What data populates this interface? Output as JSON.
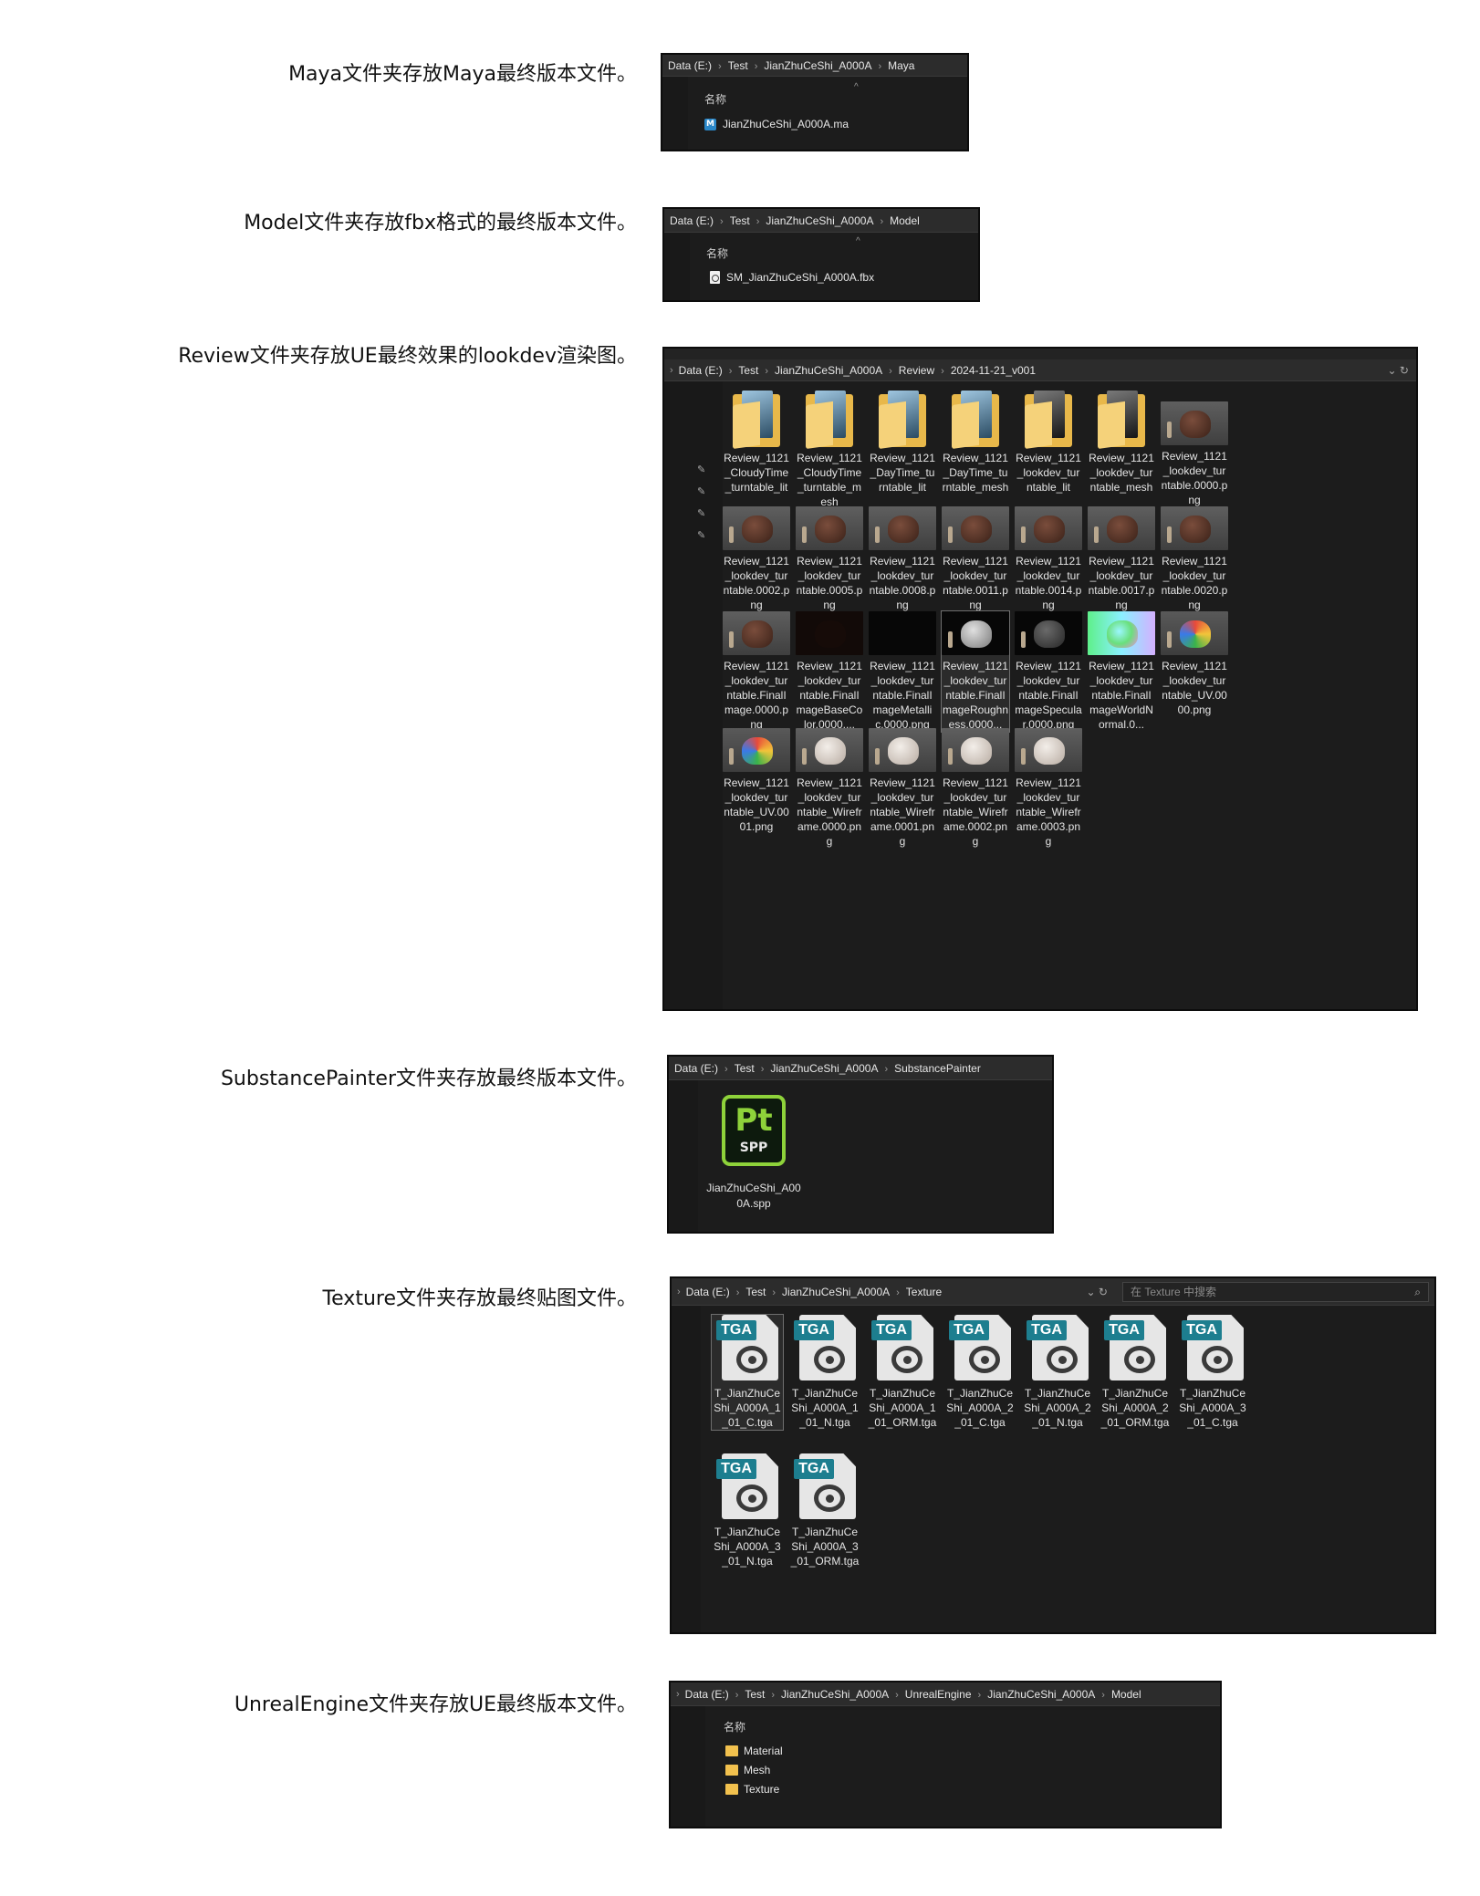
{
  "captions": {
    "maya": "Maya文件夹存放Maya最终版本文件。",
    "model": "Model文件夹存放fbx格式的最终版本文件。",
    "review": "Review文件夹存放UE最终效果的lookdev渲染图。",
    "substance": "SubstancePainter文件夹存放最终版本文件。",
    "texture": "Texture文件夹存放最终贴图文件。",
    "unreal": "UnrealEngine文件夹存放UE最终版本文件。"
  },
  "maya_window": {
    "breadcrumb": [
      "Data (E:)",
      "Test",
      "JianZhuCeShi_A000A",
      "Maya"
    ],
    "column_header": "名称",
    "file": "JianZhuCeShi_A000A.ma",
    "icon": "maya-file-icon"
  },
  "model_window": {
    "breadcrumb": [
      "Data (E:)",
      "Test",
      "JianZhuCeShi_A000A",
      "Model"
    ],
    "column_header": "名称",
    "file": "SM_JianZhuCeShi_A000A.fbx",
    "icon": "fbx-file-icon"
  },
  "review_window": {
    "breadcrumb": [
      "Data (E:)",
      "Test",
      "JianZhuCeShi_A000A",
      "Review",
      "2024-11-21_v001"
    ],
    "folders": [
      {
        "name": "Review_1121_CloudyTime_turntable_lit",
        "style": "light"
      },
      {
        "name": "Review_1121_CloudyTime_turntable_mesh",
        "style": "light"
      },
      {
        "name": "Review_1121_DayTime_turntable_lit",
        "style": "light"
      },
      {
        "name": "Review_1121_DayTime_turntable_mesh",
        "style": "light"
      },
      {
        "name": "Review_1121_lookdev_turntable_lit",
        "style": "dark"
      },
      {
        "name": "Review_1121_lookdev_turntable_mesh",
        "style": "dark"
      }
    ],
    "images": [
      {
        "name": "Review_1121_lookdev_turntable.0000.png",
        "thumb": "gray",
        "pot": "brown"
      },
      {
        "name": "Review_1121_lookdev_turntable.0002.png",
        "thumb": "gray",
        "pot": "brown"
      },
      {
        "name": "Review_1121_lookdev_turntable.0005.png",
        "thumb": "gray",
        "pot": "brown"
      },
      {
        "name": "Review_1121_lookdev_turntable.0008.png",
        "thumb": "gray",
        "pot": "brown"
      },
      {
        "name": "Review_1121_lookdev_turntable.0011.png",
        "thumb": "gray",
        "pot": "brown"
      },
      {
        "name": "Review_1121_lookdev_turntable.0014.png",
        "thumb": "gray",
        "pot": "brown"
      },
      {
        "name": "Review_1121_lookdev_turntable.0017.png",
        "thumb": "gray",
        "pot": "brown"
      },
      {
        "name": "Review_1121_lookdev_turntable.0020.png",
        "thumb": "gray",
        "pot": "brown"
      },
      {
        "name": "Review_1121_lookdev_turntable.FinalImage.0000.png",
        "thumb": "gray",
        "pot": "brown"
      },
      {
        "name": "Review_1121_lookdev_turntable.FinalImageBaseColor.0000....",
        "thumb": "dark",
        "pot": "basec"
      },
      {
        "name": "Review_1121_lookdev_turntable.FinalImageMetallic.0000.png",
        "thumb": "black",
        "pot": "none"
      },
      {
        "name": "Review_1121_lookdev_turntable.FinalImageRoughness.0000...",
        "thumb": "black",
        "pot": "rough"
      },
      {
        "name": "Review_1121_lookdev_turntable.FinalImageSpecular.0000.png",
        "thumb": "black",
        "pot": "spec"
      },
      {
        "name": "Review_1121_lookdev_turntable.FinalImageWorldNormal.0...",
        "thumb": "normal",
        "pot": "norm"
      },
      {
        "name": "Review_1121_lookdev_turntable_UV.0000.png",
        "thumb": "uv",
        "pot": "uvc"
      },
      {
        "name": "Review_1121_lookdev_turntable_UV.0001.png",
        "thumb": "uv",
        "pot": "uvc"
      },
      {
        "name": "Review_1121_lookdev_turntable_Wireframe.0000.png",
        "thumb": "gray",
        "pot": "white"
      },
      {
        "name": "Review_1121_lookdev_turntable_Wireframe.0001.png",
        "thumb": "gray",
        "pot": "white"
      },
      {
        "name": "Review_1121_lookdev_turntable_Wireframe.0002.png",
        "thumb": "gray",
        "pot": "white"
      },
      {
        "name": "Review_1121_lookdev_turntable_Wireframe.0003.png",
        "thumb": "gray",
        "pot": "white"
      }
    ]
  },
  "substance_window": {
    "breadcrumb": [
      "Data (E:)",
      "Test",
      "JianZhuCeShi_A000A",
      "SubstancePainter"
    ],
    "file": "JianZhuCeShi_A000A.spp",
    "icon_main": "Pt",
    "icon_ext": "SPP"
  },
  "texture_window": {
    "breadcrumb": [
      "Data (E:)",
      "Test",
      "JianZhuCeShi_A000A",
      "Texture"
    ],
    "search_placeholder": "在 Texture 中搜索",
    "badge": "TGA",
    "files": [
      "T_JianZhuCeShi_A000A_1_01_C.tga",
      "T_JianZhuCeShi_A000A_1_01_N.tga",
      "T_JianZhuCeShi_A000A_1_01_ORM.tga",
      "T_JianZhuCeShi_A000A_2_01_C.tga",
      "T_JianZhuCeShi_A000A_2_01_N.tga",
      "T_JianZhuCeShi_A000A_2_01_ORM.tga",
      "T_JianZhuCeShi_A000A_3_01_C.tga",
      "T_JianZhuCeShi_A000A_3_01_N.tga",
      "T_JianZhuCeShi_A000A_3_01_ORM.tga"
    ]
  },
  "unreal_window": {
    "breadcrumb": [
      "Data (E:)",
      "Test",
      "JianZhuCeShi_A000A",
      "UnrealEngine",
      "JianZhuCeShi_A000A",
      "Model"
    ],
    "column_header": "名称",
    "folders": [
      "Material",
      "Mesh",
      "Texture"
    ]
  },
  "colors": {
    "window_bg": "#1c1c1c",
    "address_bar": "#2c2c2c",
    "folder_yellow": "#f2c14e",
    "tga_badge": "#1d7e8f",
    "substance_green": "#8ed23a"
  }
}
